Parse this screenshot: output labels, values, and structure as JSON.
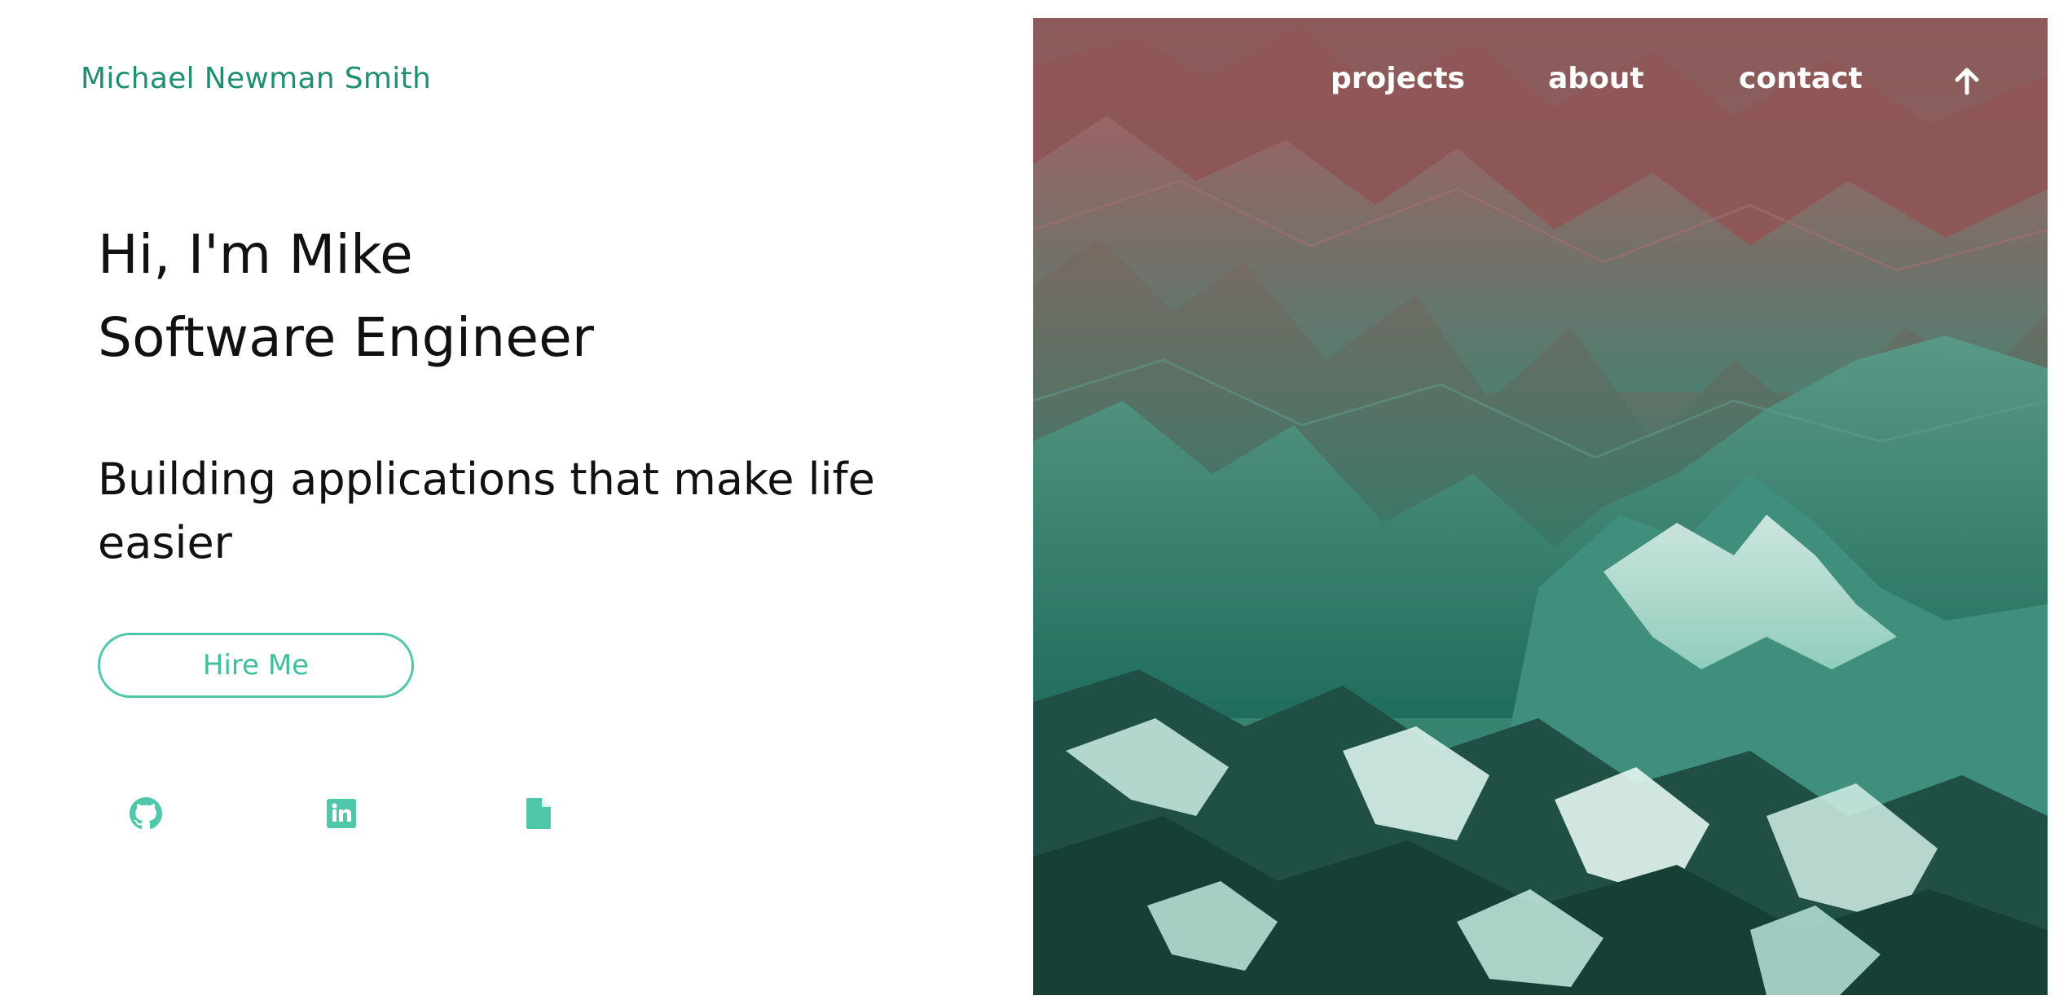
{
  "header": {
    "brand_name": "Michael Newman Smith",
    "nav": {
      "projects": "projects",
      "about": "about",
      "contact": "contact",
      "up_icon": "arrow-up-icon"
    }
  },
  "hero": {
    "greeting": "Hi, I'm Mike",
    "role": "Software Engineer",
    "tagline": "Building applications that make life easier",
    "cta_label": "Hire Me"
  },
  "social": {
    "icons": [
      "github-icon",
      "linkedin-icon",
      "document-icon"
    ]
  },
  "colors": {
    "brand": "#1f8f73",
    "accent": "#4fc7ab",
    "text": "#111111",
    "background": "#ffffff"
  }
}
